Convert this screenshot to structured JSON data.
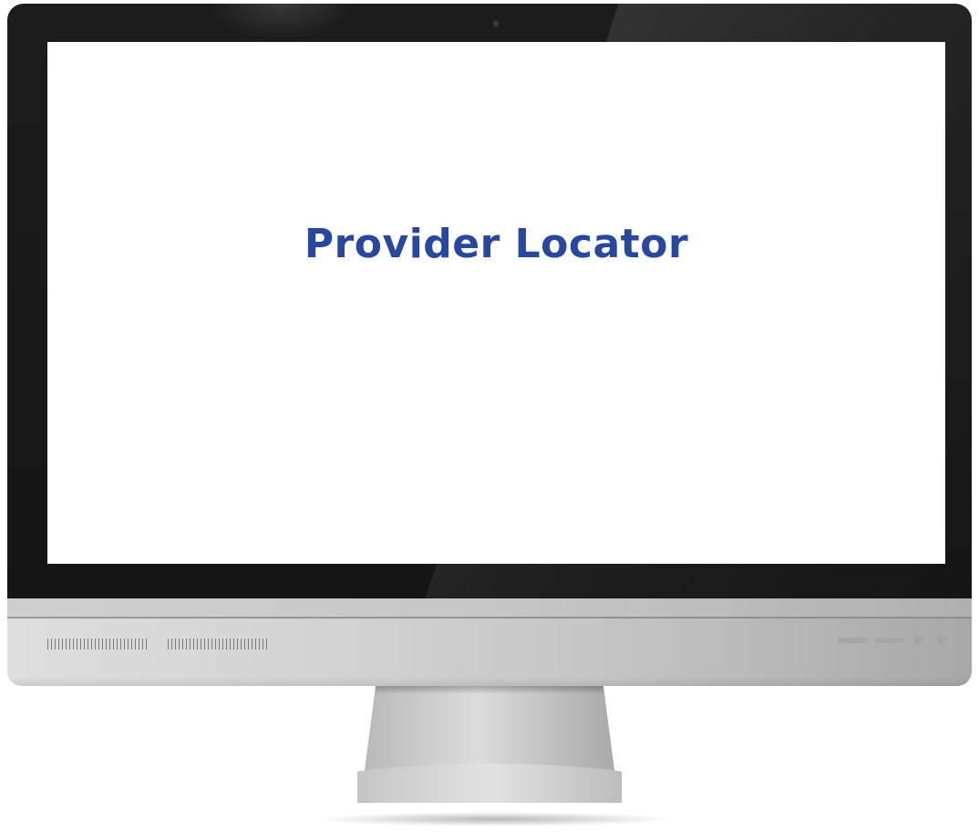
{
  "screen": {
    "title": "Provider Locator"
  },
  "colors": {
    "title_text": "#2747a0",
    "bezel": "#1c1c1c",
    "screen_background": "#ffffff",
    "chin": "#d2d2d2"
  },
  "icons": {
    "camera": "camera-icon",
    "speaker_grille": "speaker-grille-icon",
    "control_buttons": "control-button-icon",
    "power": "power-icon"
  }
}
